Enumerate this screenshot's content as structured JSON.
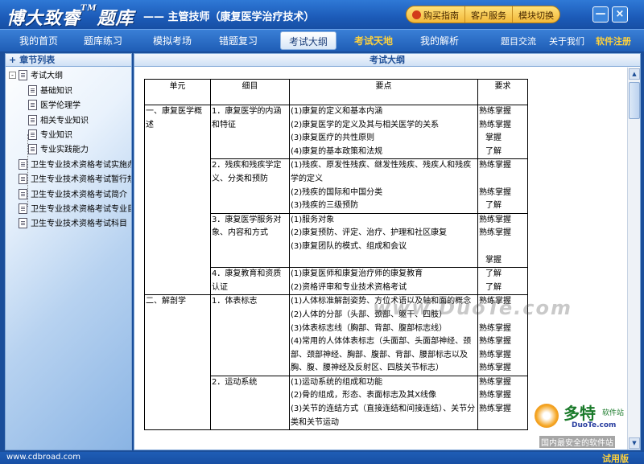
{
  "window": {
    "brand": "博大致睿",
    "brand_tm": "TM",
    "brand_suffix": "题库",
    "subtitle": "—— 主管技师（康复医学治疗技术）",
    "top_buttons": [
      "购买指南",
      "客户服务",
      "模块切换"
    ],
    "minimize": "—",
    "close": "×"
  },
  "nav": {
    "items": [
      "我的首页",
      "题库练习",
      "模拟考场",
      "错题复习",
      "考试大纲",
      "考试天地",
      "我的解析"
    ],
    "active": "考试大纲",
    "right_items": [
      "题目交流",
      "关于我们",
      "软件注册"
    ]
  },
  "sidebar": {
    "title": "章节列表",
    "root": "考试大纲",
    "children": [
      "基础知识",
      "医学伦理学",
      "相关专业知识",
      "专业知识",
      "专业实践能力"
    ],
    "others": [
      "卫生专业技术资格考试实施办",
      "卫生专业技术资格考试暂行规",
      "卫生专业技术资格考试简介",
      "卫生专业技术资格考试专业目",
      "卫生专业技术资格考试科目"
    ]
  },
  "main": {
    "title": "考试大纲",
    "table": {
      "headers": [
        "单元",
        "细目",
        "要点",
        "要求"
      ],
      "rows": [
        {
          "unit": "一、康复医学概述",
          "item": "1．康复医学的内涵和特征",
          "points": [
            "(1)康复的定义和基本内涵",
            "(2)康复医学的定义及其与相关医学的关系",
            "(3)康复医疗的共性原则",
            "(4)康复的基本政策和法规"
          ],
          "reqs": [
            "熟练掌握",
            "熟练掌握",
            "掌握",
            "了解"
          ]
        },
        {
          "unit": "",
          "item": "2．残疾和残疾学定义、分类和预防",
          "points": [
            "(1)残疾、原发性残疾、继发性残疾、残疾人和残疾学的定义",
            "(2)残疾的国际和中国分类",
            "(3)残疾的三级预防"
          ],
          "reqs": [
            "熟练掌握",
            "",
            "熟练掌握",
            "了解"
          ]
        },
        {
          "unit": "",
          "item": "3．康复医学服务对象、内容和方式",
          "points": [
            "(1)服务对象",
            "(2)康复预防、评定、治疗、护理和社区康复",
            "(3)康复团队的模式、组成和会议"
          ],
          "reqs": [
            "熟练掌握",
            "熟练掌握",
            "",
            "掌握"
          ]
        },
        {
          "unit": "",
          "item": "4．康复教育和资质认证",
          "points": [
            "(1)康复医师和康复治疗师的康复教育",
            "(2)资格评审和专业技术资格考试"
          ],
          "reqs": [
            "了解",
            "了解"
          ]
        },
        {
          "unit": "二、解剖学",
          "item": "1．体表标志",
          "points": [
            "(1)人体标准解剖姿势、方位术语以及轴和面的概念",
            "(2)人体的分部（头部、颈部、躯干、四肢）",
            "(3)体表标志线（胸部、背部、腹部标志线）",
            "(4)常用的人体体表标志（头面部、头面部神经、颈部、颈部神经、胸部、腹部、背部、腰部标志以及胸、腹、腰神经及反射区、四肢关节标志）"
          ],
          "reqs": [
            "熟练掌握",
            "",
            "熟练掌握",
            "熟练掌握",
            "熟练掌握",
            "熟练掌握"
          ]
        },
        {
          "unit": "",
          "item": "2．运动系统",
          "points": [
            "(1)运动系统的组成和功能",
            "(2)骨的组成，形态、表面标志及其X线像",
            "(3)关节的连结方式（直接连结和间接连结）、关节分类和关节运动"
          ],
          "reqs": [
            "熟练掌握",
            "熟练掌握",
            "熟练掌握"
          ]
        }
      ]
    }
  },
  "watermark": {
    "center": "www.DuoTe.com",
    "logo_big": "多特",
    "logo_small": "软件站",
    "logo_url": "DuoTe.com",
    "logo_slogan": "国内最安全的软件站"
  },
  "status": {
    "url": "www.cdbroad.com",
    "version": "试用版"
  },
  "colors": {
    "frame": "#1a4e9a",
    "accent_gold": "#ffd23c",
    "panel_header_text": "#1d4e96"
  }
}
